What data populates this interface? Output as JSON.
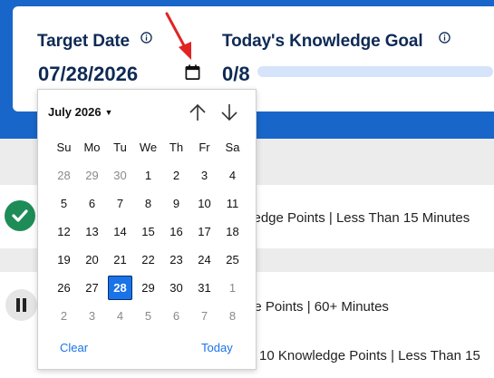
{
  "target": {
    "label": "Target Date",
    "value": "07/28/2026"
  },
  "goal": {
    "label": "Today's Knowledge Goal",
    "value": "0/8",
    "progress": 0
  },
  "rows": [
    {
      "text": "kedge Points | Less Than 15 Minutes",
      "status": "complete"
    },
    {
      "text": "ge Points | 60+ Minutes",
      "status": "paused"
    },
    {
      "text": "10 Knowledge Points |  Less Than 15"
    }
  ],
  "calendar": {
    "month_label": "July 2026",
    "weekdays": [
      "Su",
      "Mo",
      "Tu",
      "We",
      "Th",
      "Fr",
      "Sa"
    ],
    "weeks": [
      [
        "28",
        "29",
        "30",
        "1",
        "2",
        "3",
        "4"
      ],
      [
        "5",
        "6",
        "7",
        "8",
        "9",
        "10",
        "11"
      ],
      [
        "12",
        "13",
        "14",
        "15",
        "16",
        "17",
        "18"
      ],
      [
        "19",
        "20",
        "21",
        "22",
        "23",
        "24",
        "25"
      ],
      [
        "26",
        "27",
        "28",
        "29",
        "30",
        "31",
        "1"
      ],
      [
        "2",
        "3",
        "4",
        "5",
        "6",
        "7",
        "8"
      ]
    ],
    "other_month": [
      [
        0,
        0
      ],
      [
        0,
        1
      ],
      [
        0,
        2
      ],
      [
        4,
        6
      ],
      [
        5,
        0
      ],
      [
        5,
        1
      ],
      [
        5,
        2
      ],
      [
        5,
        3
      ],
      [
        5,
        4
      ],
      [
        5,
        5
      ],
      [
        5,
        6
      ]
    ],
    "selected": [
      4,
      2
    ],
    "clear_label": "Clear",
    "today_label": "Today"
  },
  "colors": {
    "brand": "#1866c9",
    "accent": "#1a73e8",
    "complete": "#1e8c57",
    "arrow": "#e02424"
  }
}
